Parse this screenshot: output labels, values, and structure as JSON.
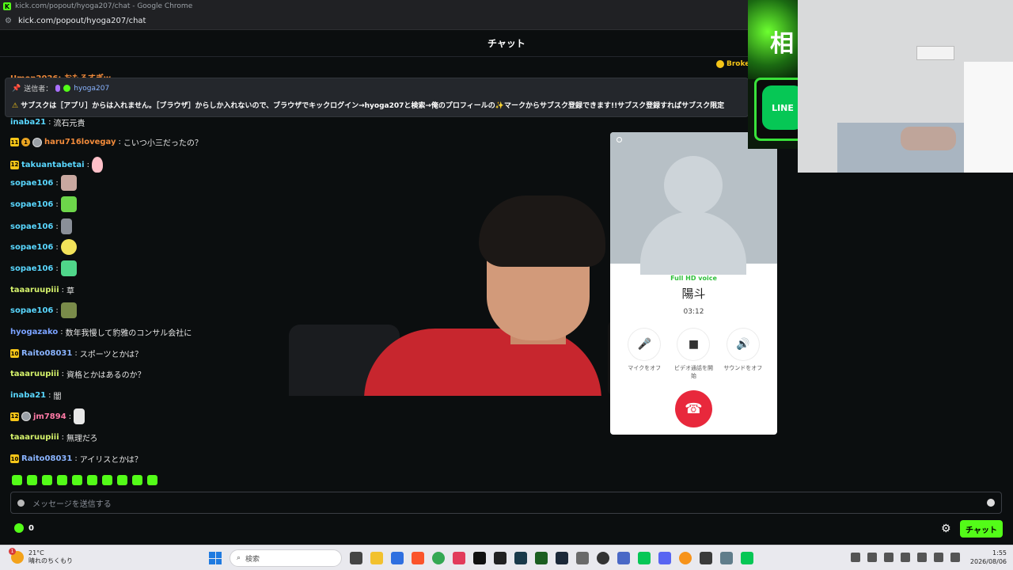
{
  "browser": {
    "title": "kick.com/popout/hyoga207/chat - Google Chrome",
    "url": "kick.com/popout/hyoga207/chat",
    "favicon": "K"
  },
  "chat": {
    "header": "チャット",
    "partial_top_user": "Umon2026: おもろすぎw",
    "broken_badge": "Broke",
    "pinned": {
      "sender_label": "送信者：",
      "sender": "hyoga207",
      "text": "サブスクは［アプリ］からは入れません。［ブラウザ］からしか入れないので、ブラウザでキックログイン→hyoga207と検索→俺のプロフィールの✨マークからサブスク登録できます!!サブスク登録すればサブスク限定"
    },
    "partial_row": {
      "user": "inaba21",
      "message": "流石元貴"
    },
    "messages": [
      {
        "badge": "11",
        "coin": "1",
        "user": "haru716lovegay",
        "color": "#f28b3b",
        "message": "こいつ小三だったの？"
      },
      {
        "badge": "12",
        "user": "takuantabetai",
        "color": "#59d7ff",
        "message": ""
      },
      {
        "user": "sopae106",
        "color": "#59d7ff",
        "message": ""
      },
      {
        "user": "sopae106",
        "color": "#59d7ff",
        "message": ""
      },
      {
        "user": "sopae106",
        "color": "#59d7ff",
        "message": ""
      },
      {
        "user": "sopae106",
        "color": "#59d7ff",
        "message": ""
      },
      {
        "user": "sopae106",
        "color": "#59d7ff",
        "message": ""
      },
      {
        "user": "taaaruupiii",
        "color": "#d5f26b",
        "message": "草"
      },
      {
        "user": "sopae106",
        "color": "#59d7ff",
        "message": ""
      },
      {
        "user": "hyogazako",
        "color": "#7aa2ff",
        "message": "数年我慢して豹雅のコンサル会社に"
      },
      {
        "badge": "10",
        "user": "Raito08031",
        "color": "#8ab4ff",
        "message": "スポーツとかは？"
      },
      {
        "user": "taaaruupiii",
        "color": "#d5f26b",
        "message": "資格とかはあるのか？"
      },
      {
        "user": "inaba21",
        "color": "#59d7ff",
        "message": "闇"
      },
      {
        "badge": "12",
        "user": "jm7894",
        "color": "#ff7aa6",
        "message": ""
      },
      {
        "user": "taaaruupiii",
        "color": "#d5f26b",
        "message": "無理だろ"
      },
      {
        "badge": "10",
        "user": "Raito08031",
        "color": "#8ab4ff",
        "message": "アイリスとかは？"
      }
    ],
    "input_placeholder": "メッセージを送信する",
    "points": "0",
    "send_label": "チャット"
  },
  "call": {
    "quality": "Full HD voice",
    "name": "陽斗",
    "duration": "03:12",
    "controls": [
      {
        "icon": "mic-icon",
        "glyph": "🎤",
        "label": "マイクをオフ"
      },
      {
        "icon": "video-icon",
        "glyph": "■",
        "label": "ビデオ通話を開始"
      },
      {
        "icon": "speaker-icon",
        "glyph": "🔊",
        "label": "サウンドをオフ"
      }
    ],
    "hangup_glyph": "☎"
  },
  "promo": {
    "kanji": "相",
    "line_label": "LINE"
  },
  "taskbar": {
    "weather_temp": "21°C",
    "weather_desc": "晴れのちくもり",
    "weather_badge": "1",
    "search_placeholder": "検索",
    "time": "1:55",
    "date": "2026/08/06"
  },
  "colors": {
    "kick_green": "#53fc18",
    "hangup_red": "#e8283c",
    "line_green": "#06c755"
  }
}
